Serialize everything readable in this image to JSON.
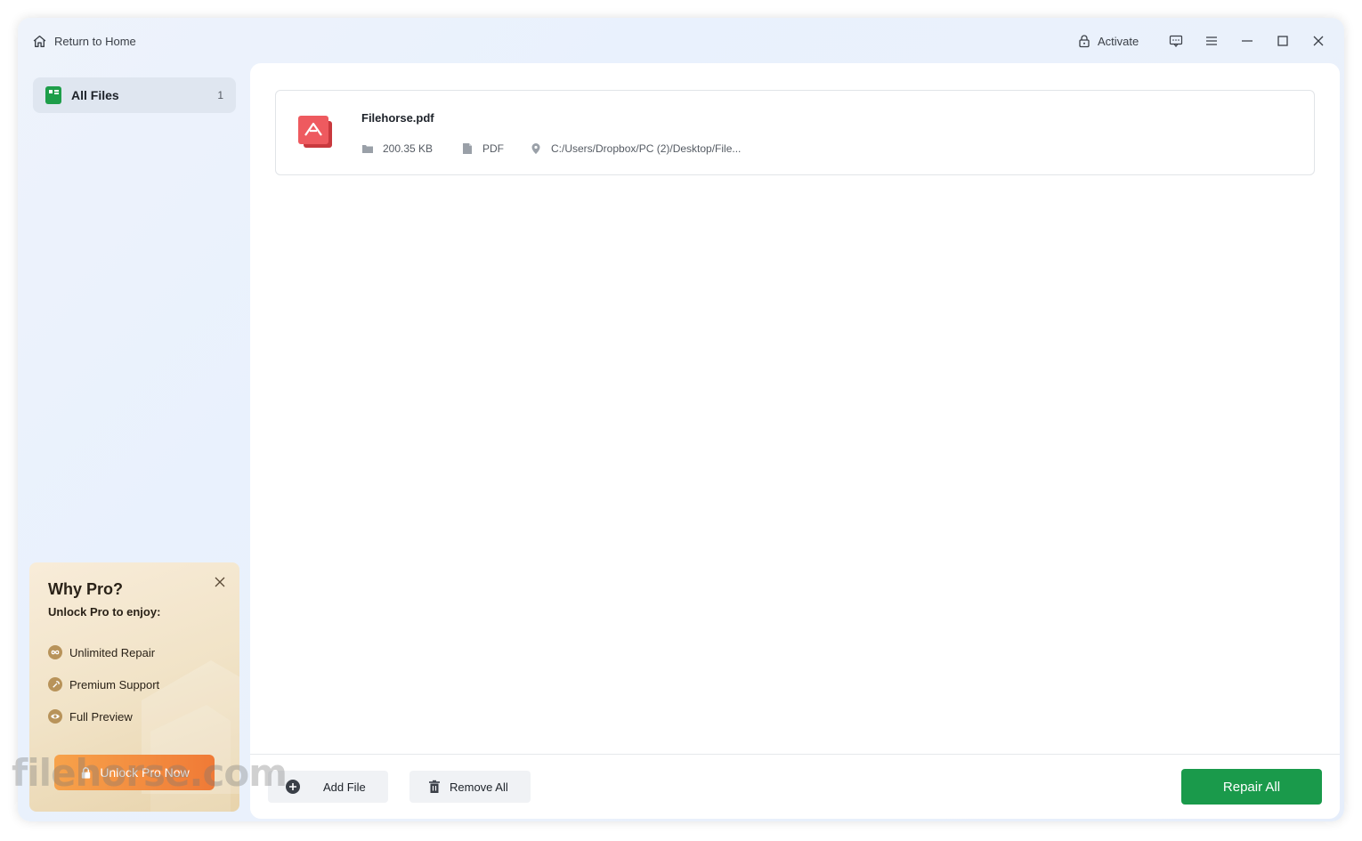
{
  "titlebar": {
    "home_label": "Return to Home",
    "activate_label": "Activate"
  },
  "sidebar": {
    "items": [
      {
        "label": "All Files",
        "count": "1"
      }
    ]
  },
  "pro_card": {
    "title": "Why Pro?",
    "subtitle": "Unlock Pro to enjoy:",
    "features": [
      {
        "label": "Unlimited Repair",
        "icon": "infinity-icon"
      },
      {
        "label": "Premium Support",
        "icon": "wrench-icon"
      },
      {
        "label": "Full Preview",
        "icon": "eye-icon"
      }
    ],
    "button_label": "Unlock Pro Now"
  },
  "watermark": "filehorse.com",
  "files": [
    {
      "name": "Filehorse.pdf",
      "size": "200.35 KB",
      "type": "PDF",
      "path": "C:/Users/Dropbox/PC (2)/Desktop/File..."
    }
  ],
  "footer": {
    "add_label": "Add File",
    "remove_label": "Remove All",
    "repair_label": "Repair All"
  },
  "colors": {
    "accent": "#1a9a4b",
    "pdf": "#e5484d",
    "unlock": "#f07a36"
  }
}
